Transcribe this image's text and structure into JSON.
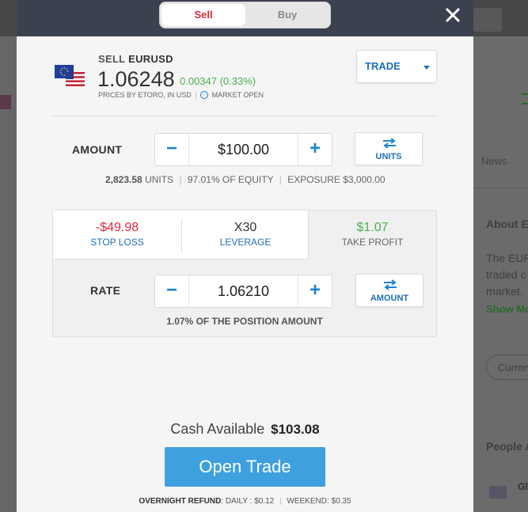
{
  "background": {
    "news_tab": "News",
    "about_heading": "About E",
    "about_lines": [
      "The EUR",
      "traded c",
      "market."
    ],
    "show_more": "Show Mo",
    "currency_pill": "Curren",
    "people_heading": "People A",
    "people_item": "Gl"
  },
  "tabs": {
    "sell": "Sell",
    "buy": "Buy"
  },
  "instrument": {
    "action": "SELL",
    "symbol": "EURUSD",
    "price": "1.06248",
    "change": "0.00347 (0.33%)",
    "prices_by": "PRICES BY ETORO, IN USD",
    "market_status": "MARKET OPEN"
  },
  "order_type": {
    "label": "TRADE"
  },
  "amount": {
    "label": "AMOUNT",
    "value": "$100.00",
    "toggle_label": "UNITS",
    "units_value": "2,823.58",
    "units_suffix": "UNITS",
    "equity": "97.01% OF EQUITY",
    "exposure_label": "EXPOSURE",
    "exposure_value": "$3,000.00"
  },
  "stop_loss": {
    "value": "-$49.98",
    "label": "STOP LOSS"
  },
  "leverage": {
    "value": "X30",
    "label": "LEVERAGE"
  },
  "take_profit": {
    "value": "$1.07",
    "label": "TAKE PROFIT"
  },
  "rate": {
    "label": "RATE",
    "value": "1.06210",
    "toggle_label": "AMOUNT",
    "position_note": "1.07% OF THE POSITION AMOUNT"
  },
  "cash": {
    "label": "Cash Available",
    "value": "$103.08"
  },
  "open_trade_label": "Open Trade",
  "overnight": {
    "label": "OVERNIGHT REFUND",
    "daily": ": DAILY : $0.12",
    "weekend": "WEEKEND: $0.35"
  },
  "colors": {
    "sell": "#e0283a",
    "positive": "#4caf50",
    "accent": "#1d85d0",
    "open_button": "#3fa0e0",
    "header": "#3c4150"
  },
  "icons": [
    "close-icon",
    "eu-flag-icon",
    "us-flag-icon",
    "clock-icon",
    "chevron-down-icon",
    "swap-icon",
    "minus-icon",
    "plus-icon"
  ]
}
